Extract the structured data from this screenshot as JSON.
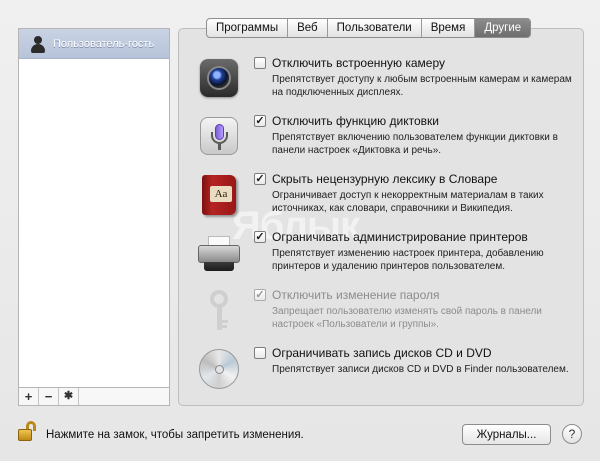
{
  "users": {
    "selected": "Пользователь-гость"
  },
  "list_buttons": {
    "add": "+",
    "remove": "−",
    "settings": "✱"
  },
  "tabs": [
    {
      "label": "Программы",
      "active": false
    },
    {
      "label": "Веб",
      "active": false
    },
    {
      "label": "Пользователи",
      "active": false
    },
    {
      "label": "Время",
      "active": false
    },
    {
      "label": "Другие",
      "active": true
    }
  ],
  "options": [
    {
      "label": "Отключить встроенную камеру",
      "description": "Препятствует доступу к любым встроенным камерам и камерам на подключенных дисплеях.",
      "checked": false,
      "disabled": false,
      "icon": "camera-icon"
    },
    {
      "label": "Отключить функцию диктовки",
      "description": "Препятствует включению пользователем функции диктовки в панели настроек «Диктовка и речь».",
      "checked": true,
      "disabled": false,
      "icon": "microphone-icon"
    },
    {
      "label": "Скрыть нецензурную лексику в Словаре",
      "description": "Ограничивает доступ к некорректным материалам в таких источниках, как словари, справочники и Википедия.",
      "checked": true,
      "disabled": false,
      "icon": "dictionary-icon",
      "icon_text": "Aa"
    },
    {
      "label": "Ограничивать администрирование принтеров",
      "description": "Препятствует изменению настроек принтера, добавлению принтеров и удалению принтеров пользователем.",
      "checked": true,
      "disabled": false,
      "icon": "printer-icon"
    },
    {
      "label": "Отключить изменение пароля",
      "description": "Запрещает пользователю изменять свой пароль в панели настроек «Пользователи и группы».",
      "checked": true,
      "disabled": true,
      "icon": "key-icon"
    },
    {
      "label": "Ограничивать запись дисков CD и DVD",
      "description": "Препятствует записи дисков CD и DVD в Finder пользователем.",
      "checked": false,
      "disabled": false,
      "icon": "disc-icon"
    }
  ],
  "footer": {
    "lock_text": "Нажмите на замок, чтобы запретить изменения.",
    "logs_button": "Журналы...",
    "help_button": "?"
  },
  "watermark": "Яблык"
}
